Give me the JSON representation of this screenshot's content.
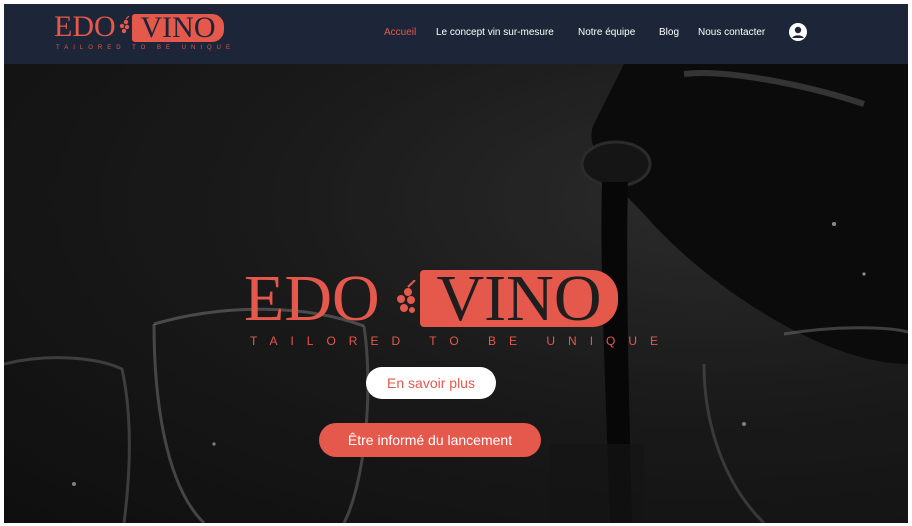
{
  "colors": {
    "accent": "#e5584c",
    "navbar": "#1d2538",
    "white": "#ffffff"
  },
  "brand": {
    "word1": "EDO",
    "word2": "VINO",
    "tagline": "TAILORED TO BE UNIQUE"
  },
  "nav": {
    "items": [
      {
        "label": "Accueil",
        "active": true
      },
      {
        "label": "Le concept vin sur-mesure",
        "active": false
      },
      {
        "label": "Notre équipe",
        "active": false
      },
      {
        "label": "Blog",
        "active": false
      },
      {
        "label": "Nous contacter",
        "active": false
      }
    ],
    "account_icon": "user-circle-icon"
  },
  "hero": {
    "learn_more_label": "En savoir plus",
    "notify_label": "Être informé du lancement"
  }
}
